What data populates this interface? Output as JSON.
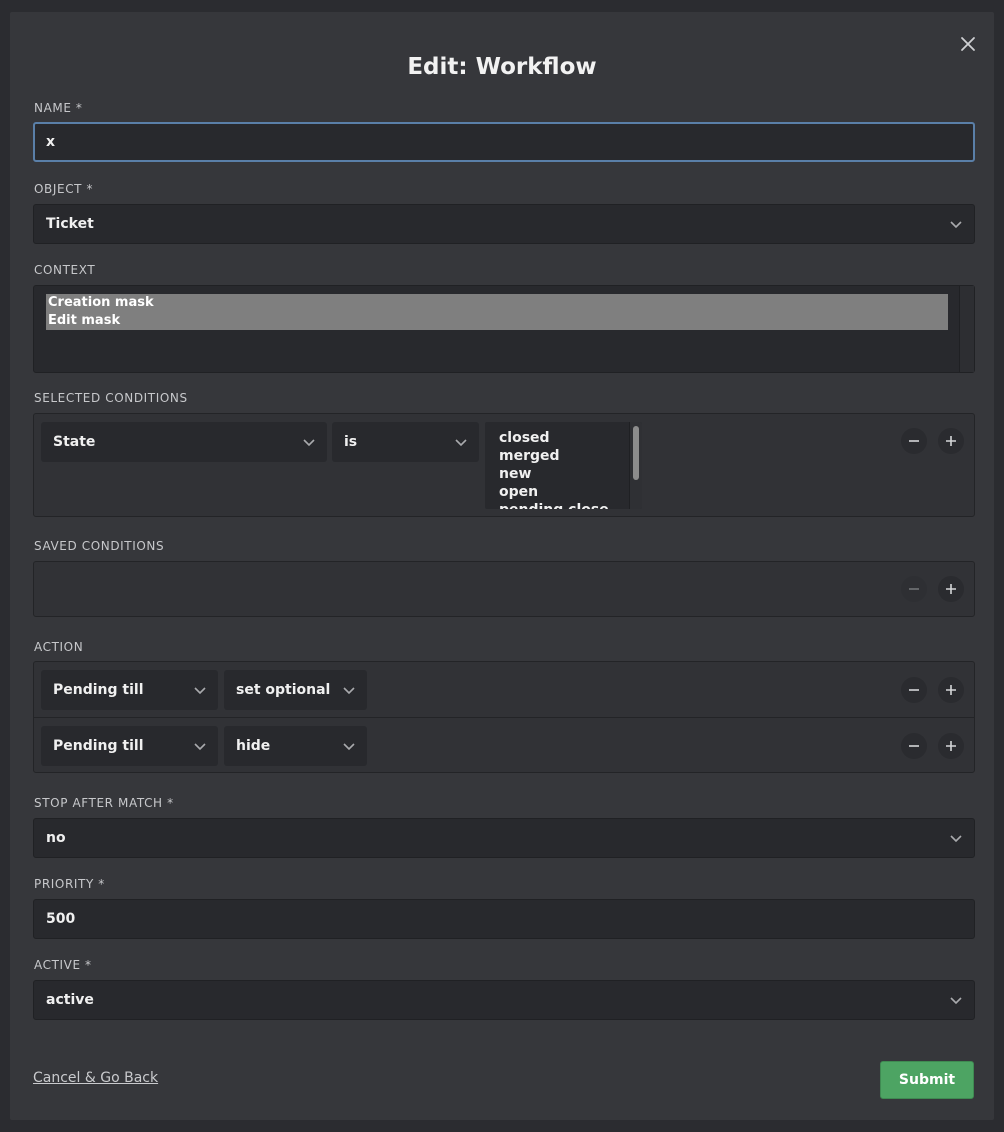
{
  "modal": {
    "title": "Edit: Workflow",
    "close_icon": "close-icon"
  },
  "name": {
    "label": "NAME *",
    "value": "x"
  },
  "object": {
    "label": "OBJECT *",
    "value": "Ticket"
  },
  "context": {
    "label": "CONTEXT",
    "options": [
      "Creation mask",
      "Edit mask"
    ]
  },
  "selected_conditions": {
    "label": "SELECTED CONDITIONS",
    "attribute": "State",
    "operator": "is",
    "values": [
      "closed",
      "merged",
      "new",
      "open",
      "pending close"
    ]
  },
  "saved_conditions": {
    "label": "SAVED CONDITIONS"
  },
  "action": {
    "label": "ACTION",
    "rows": [
      {
        "attribute": "Pending till",
        "operation": "set optional"
      },
      {
        "attribute": "Pending till",
        "operation": "hide"
      }
    ]
  },
  "stop_after_match": {
    "label": "STOP AFTER MATCH *",
    "value": "no"
  },
  "priority": {
    "label": "PRIORITY *",
    "value": "500"
  },
  "active": {
    "label": "ACTIVE *",
    "value": "active"
  },
  "footer": {
    "cancel_label": "Cancel & Go Back",
    "submit_label": "Submit"
  },
  "colors": {
    "submit": "#4da463",
    "focus_border": "#5a7fa8",
    "modal_bg": "#36373b"
  }
}
